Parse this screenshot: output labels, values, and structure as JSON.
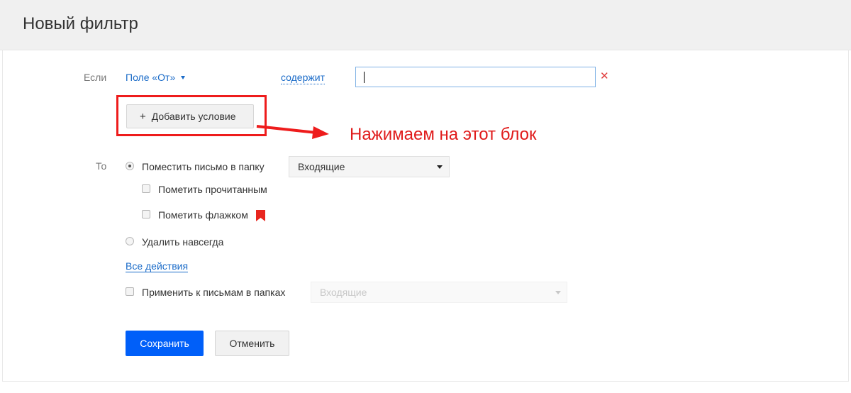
{
  "header": {
    "title": "Новый фильтр"
  },
  "condition": {
    "if_label": "Если",
    "field_select": "Поле «От»",
    "operator": "содержит",
    "value": "",
    "add_condition_label": "Добавить условие"
  },
  "annotation": {
    "text": "Нажимаем на этот блок",
    "color": "#e01b1b"
  },
  "actions": {
    "then_label": "То",
    "move_to_folder_label": "Поместить письмо в папку",
    "folder_select": "Входящие",
    "mark_read_label": "Пометить прочитанным",
    "mark_flag_label": "Пометить флажком",
    "delete_forever_label": "Удалить навсегда",
    "all_actions_link": "Все действия",
    "apply_to_folders_label": "Применить к письмам в папках",
    "apply_folder_select": "Входящие"
  },
  "buttons": {
    "save": "Сохранить",
    "cancel": "Отменить"
  },
  "colors": {
    "accent": "#005ff9",
    "link": "#1a6bc8",
    "remove": "#e03a3a",
    "flag": "#e8261f"
  }
}
